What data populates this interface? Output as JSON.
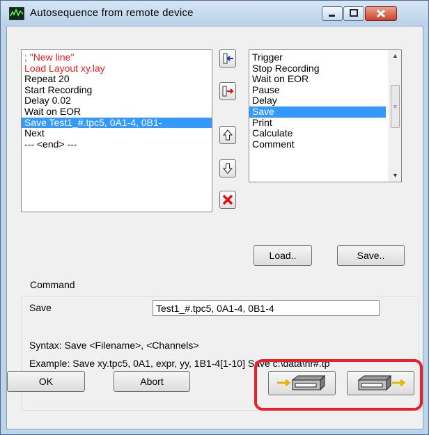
{
  "window": {
    "title": "Autosequence from remote device"
  },
  "sequence_list": {
    "items": [
      {
        "text": "; \"New line\"",
        "style": "red"
      },
      {
        "text": "Load Layout xy.lay",
        "style": "red"
      },
      {
        "text": "Repeat 20",
        "style": "normal"
      },
      {
        "text": "Start Recording",
        "style": "normal"
      },
      {
        "text": "Delay 0.02",
        "style": "normal"
      },
      {
        "text": "Wait on EOR",
        "style": "normal"
      },
      {
        "text": "Save Test1_#.tpc5, 0A1-4, 0B1-",
        "style": "selected"
      },
      {
        "text": "Next",
        "style": "normal"
      },
      {
        "text": "--- <end> ---",
        "style": "normal"
      }
    ]
  },
  "command_palette": {
    "items": [
      "Trigger",
      "Stop Recording",
      "Wait on EOR",
      "Pause",
      "Delay",
      "Save",
      "Print",
      "Calculate",
      "Comment"
    ],
    "selected": "Save"
  },
  "buttons": {
    "load": "Load..",
    "save": "Save..",
    "ok": "OK",
    "abort": "Abort"
  },
  "command": {
    "group_label": "Command",
    "name": "Save",
    "value": "Test1_#.tpc5, 0A1-4, 0B1-4",
    "syntax": "Syntax:   Save <Filename>, <Channels>",
    "example": "Example:   Save xy.tpc5, 0A1, expr, yy, 1B1-4[1-10]     Save  c:\\data\\nr#.tp"
  },
  "icons": {
    "insert": "insert-left-arrow-icon",
    "append": "insert-right-arrow-icon",
    "up": "move-up-icon",
    "down": "move-down-icon",
    "delete": "delete-x-icon",
    "send": "send-to-device-icon",
    "receive": "receive-from-device-icon"
  },
  "colors": {
    "selection": "#3399ff",
    "red_text": "#e81a1a",
    "highlight": "#e8202a"
  }
}
